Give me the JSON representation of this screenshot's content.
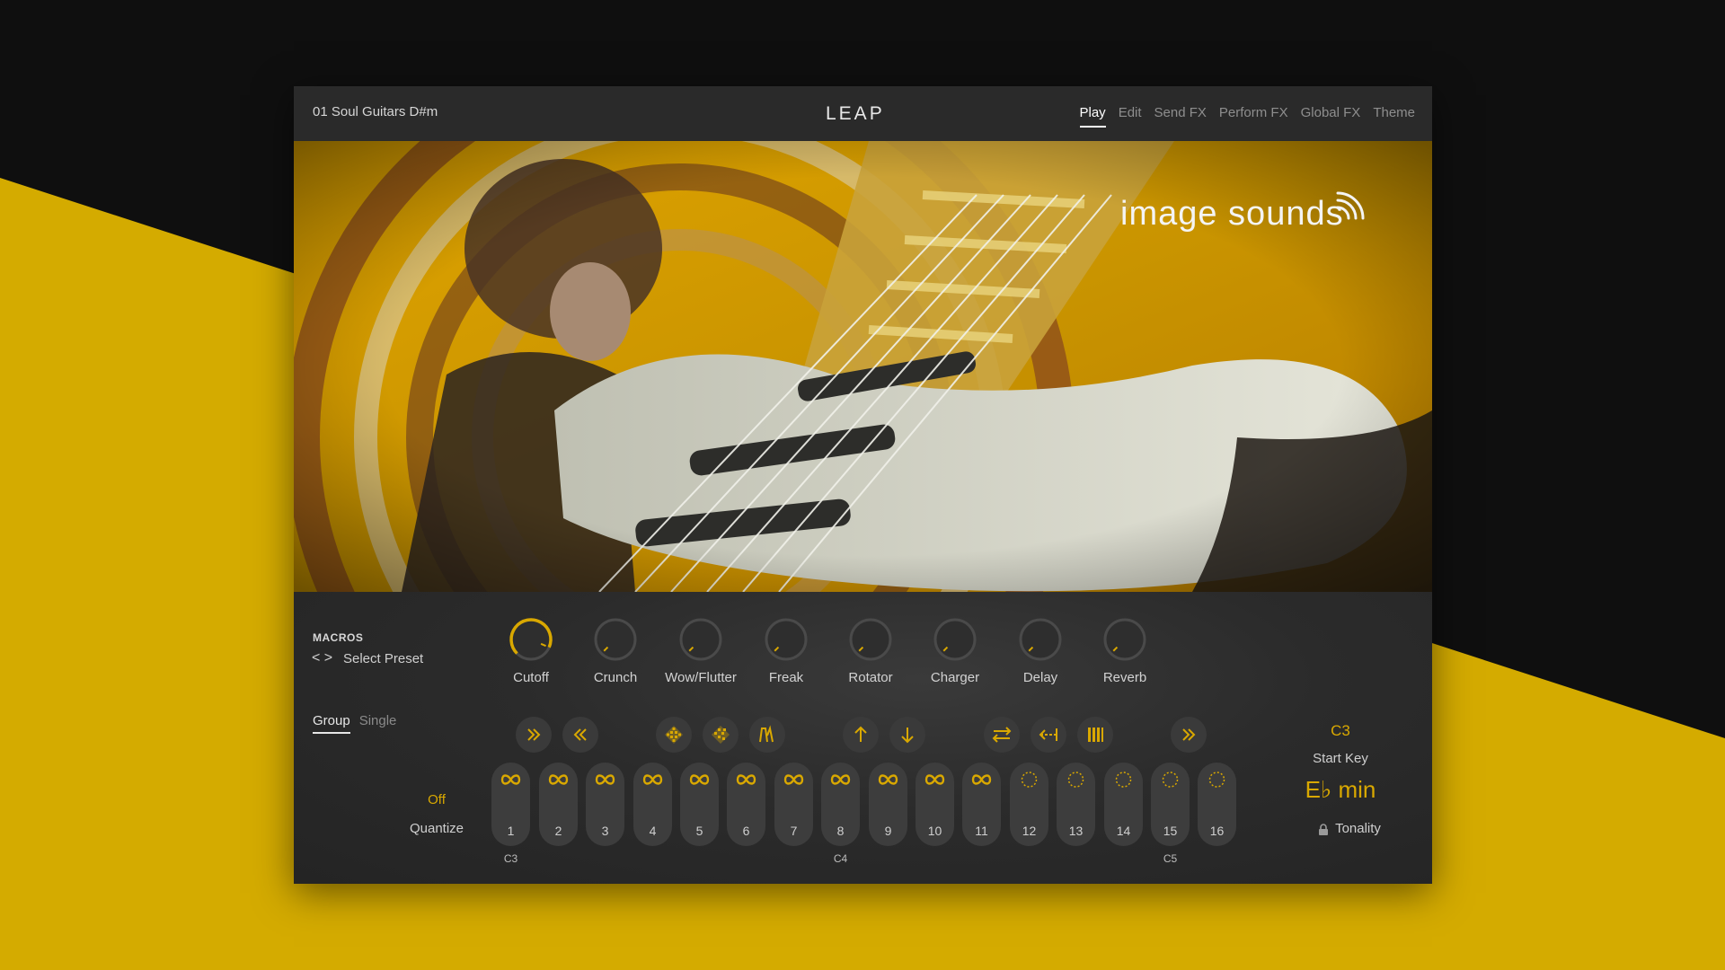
{
  "header": {
    "preset_name": "01 Soul Guitars D#m",
    "logo": "LEAP",
    "tabs": [
      {
        "label": "Play",
        "active": true
      },
      {
        "label": "Edit",
        "active": false
      },
      {
        "label": "Send FX",
        "active": false
      },
      {
        "label": "Perform FX",
        "active": false
      },
      {
        "label": "Global FX",
        "active": false
      },
      {
        "label": "Theme",
        "active": false
      }
    ]
  },
  "artwork": {
    "brand": "image sounds",
    "brand_icon": "wifi-waves-icon"
  },
  "macros": {
    "title": "MACROS",
    "nav_arrows": "< >",
    "select_preset": "Select Preset",
    "knobs": [
      {
        "label": "Cutoff",
        "value": 0.92
      },
      {
        "label": "Crunch",
        "value": 0.0
      },
      {
        "label": "Wow/Flutter",
        "value": 0.0
      },
      {
        "label": "Freak",
        "value": 0.0
      },
      {
        "label": "Rotator",
        "value": 0.0
      },
      {
        "label": "Charger",
        "value": 0.0
      },
      {
        "label": "Delay",
        "value": 0.0
      },
      {
        "label": "Reverb",
        "value": 0.0
      }
    ]
  },
  "mode": {
    "tabs": [
      {
        "label": "Group",
        "active": true
      },
      {
        "label": "Single",
        "active": false
      }
    ]
  },
  "quantize": {
    "value": "Off",
    "label": "Quantize"
  },
  "fx_buttons": [
    {
      "icon": "double-chevron-right-icon"
    },
    {
      "icon": "double-chevron-left-icon"
    },
    {
      "icon": "diamond-pattern-icon"
    },
    {
      "icon": "diamond-pattern-alt-icon"
    },
    {
      "icon": "envelope-shape-icon"
    },
    {
      "icon": "arrow-up-icon"
    },
    {
      "icon": "arrow-down-icon"
    },
    {
      "icon": "swap-arrows-icon"
    },
    {
      "icon": "reverse-dotted-arrow-icon"
    },
    {
      "icon": "bars-icon"
    },
    {
      "icon": "double-chevron-right-icon"
    }
  ],
  "pads": [
    {
      "number": "1",
      "icon": "infinity-icon"
    },
    {
      "number": "2",
      "icon": "infinity-icon"
    },
    {
      "number": "3",
      "icon": "infinity-icon"
    },
    {
      "number": "4",
      "icon": "infinity-icon"
    },
    {
      "number": "5",
      "icon": "infinity-icon"
    },
    {
      "number": "6",
      "icon": "infinity-icon"
    },
    {
      "number": "7",
      "icon": "infinity-icon"
    },
    {
      "number": "8",
      "icon": "infinity-icon"
    },
    {
      "number": "9",
      "icon": "infinity-icon"
    },
    {
      "number": "10",
      "icon": "infinity-icon"
    },
    {
      "number": "11",
      "icon": "infinity-icon"
    },
    {
      "number": "12",
      "icon": "dotted-circle-icon"
    },
    {
      "number": "13",
      "icon": "dotted-circle-icon"
    },
    {
      "number": "14",
      "icon": "dotted-circle-icon"
    },
    {
      "number": "15",
      "icon": "dotted-circle-icon"
    },
    {
      "number": "16",
      "icon": "dotted-circle-icon"
    }
  ],
  "octave_labels": [
    "C3",
    "C4",
    "C5"
  ],
  "start_key": {
    "value": "C3",
    "label": "Start Key"
  },
  "tonality": {
    "value": "E♭ min",
    "label": "Tonality",
    "icon": "lock-icon"
  },
  "colors": {
    "accent": "#d9a800",
    "background_stripe": "#d4ab00",
    "panel": "#252525",
    "pad": "#3d3d3d"
  }
}
